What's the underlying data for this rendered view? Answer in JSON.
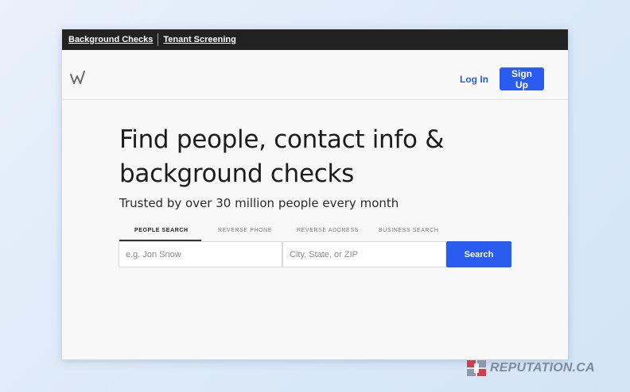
{
  "topbar": {
    "links": [
      "Background Checks",
      "Tenant Screening"
    ]
  },
  "navbar": {
    "logo_icon": "w-logo-icon",
    "login_label": "Log In",
    "signup_label": "Sign Up",
    "accent_color": "#2b5cf0"
  },
  "hero": {
    "headline_line1": "Find people, contact info &",
    "headline_line2": "background checks",
    "subhead": "Trusted by over 30 million people every month"
  },
  "search": {
    "tabs": [
      "PEOPLE SEARCH",
      "REVERSE PHONE",
      "REVERSE ADDRESS",
      "BUSINESS SEARCH"
    ],
    "active_tab": "PEOPLE SEARCH",
    "name_placeholder": "e.g. Jon Snow",
    "location_placeholder": "City, State, or ZIP",
    "button_label": "Search"
  },
  "watermark": {
    "text": "REPUTATION.CA",
    "icon": "reputation-logo-icon"
  }
}
